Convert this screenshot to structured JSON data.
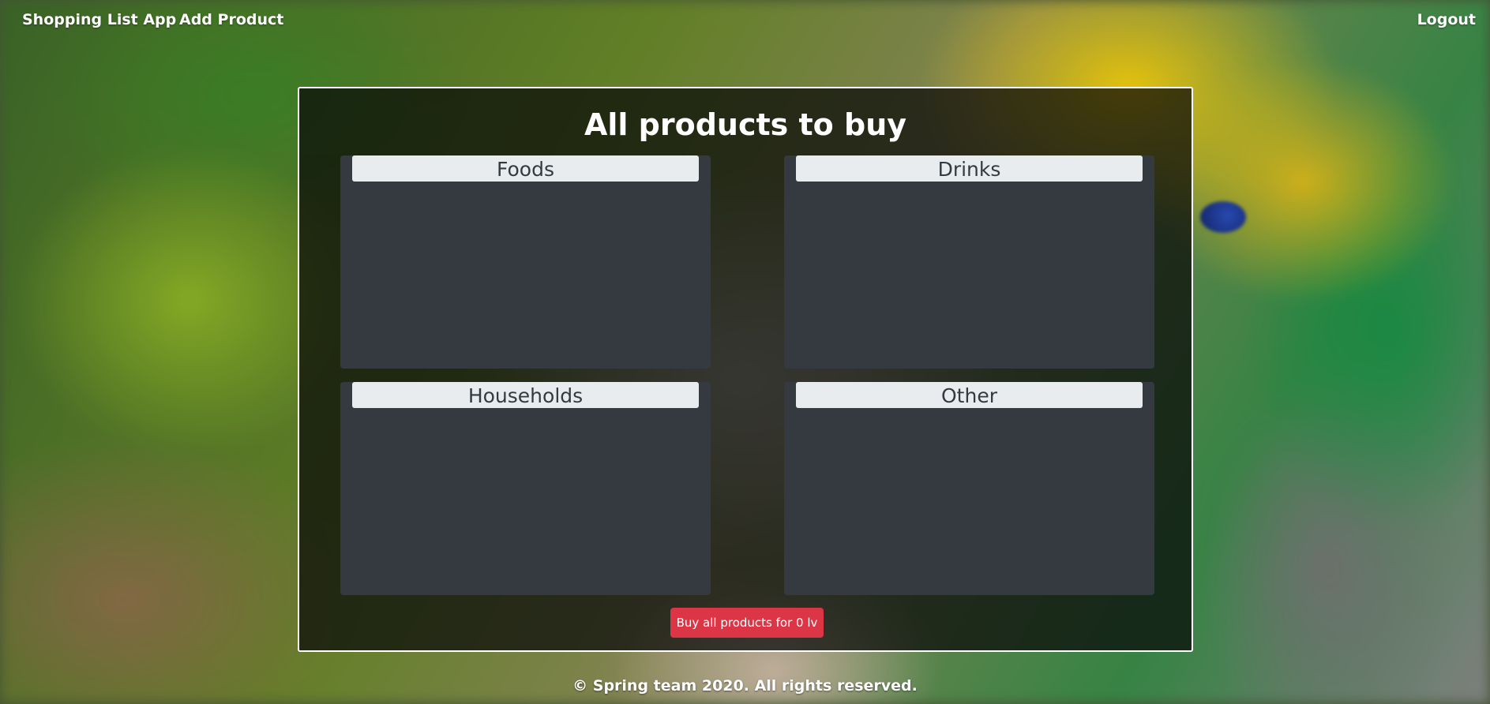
{
  "nav": {
    "brand": "Shopping List App",
    "add_product": "Add Product",
    "logout": "Logout"
  },
  "main": {
    "title": "All products to buy",
    "categories": [
      {
        "label": "Foods",
        "items": []
      },
      {
        "label": "Drinks",
        "items": []
      },
      {
        "label": "Households",
        "items": []
      },
      {
        "label": "Other",
        "items": []
      }
    ],
    "buy_button": "Buy all products for 0 lv"
  },
  "footer": {
    "text": "© Spring team 2020. All rights reserved."
  },
  "colors": {
    "buy_button": "#dc3545",
    "category_bg": "#343a40",
    "category_header_bg": "#e9ecef",
    "panel_border": "#ffffff"
  },
  "background": {
    "icon": "grocery-photo-image"
  }
}
